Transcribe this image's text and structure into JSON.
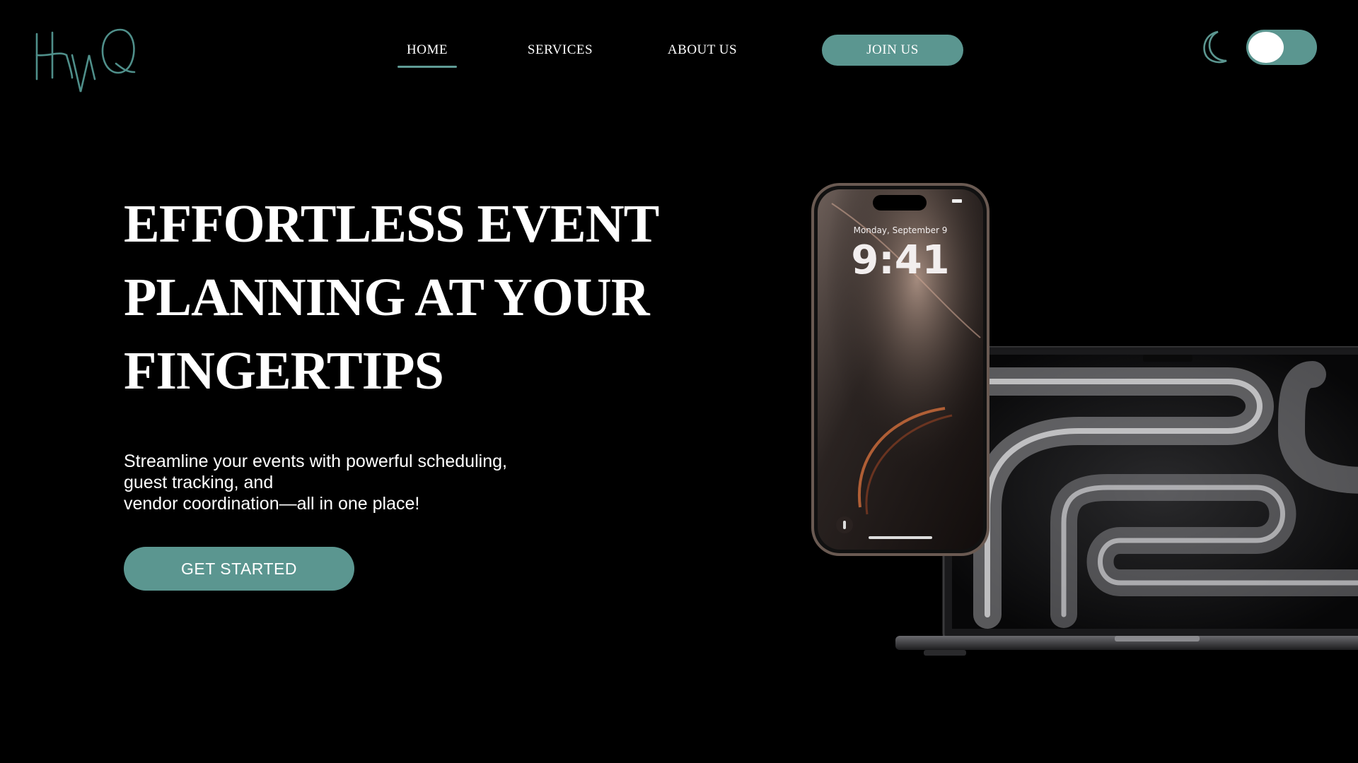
{
  "brand": {
    "logo_text": "HMQ",
    "accent": "#5b9690"
  },
  "nav": {
    "items": [
      {
        "label": "HOME",
        "active": true
      },
      {
        "label": "SERVICES",
        "active": false
      },
      {
        "label": "ABOUT US",
        "active": false
      }
    ],
    "join_label": "JOIN US"
  },
  "theme": {
    "icon": "moon-icon",
    "dark_mode": true
  },
  "hero": {
    "title_lines": [
      "EFFORTLESS EVENT",
      "PLANNING AT YOUR",
      "FINGERTIPS"
    ],
    "subtitle_lines": [
      "Streamline your events with powerful scheduling,",
      "guest tracking, and",
      "vendor coordination—all in one place!"
    ],
    "cta_label": "GET STARTED"
  },
  "phone": {
    "date": "Monday, September 9",
    "time": "9:41"
  },
  "colors": {
    "background": "#000000",
    "text": "#ffffff",
    "accent": "#5b9690"
  }
}
